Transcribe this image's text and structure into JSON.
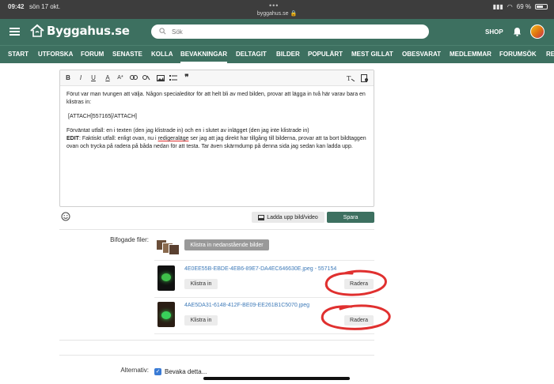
{
  "status_bar": {
    "time": "09:42",
    "date": "sön 17 okt.",
    "url": "byggahus.se 🔒",
    "battery": "69 %"
  },
  "header": {
    "logo": "Byggahus.se",
    "search_placeholder": "Sök",
    "shop": "SHOP"
  },
  "nav": {
    "items": [
      "START",
      "UTFORSKA",
      "FORUM",
      "SENASTE",
      "KOLLA",
      "BEVAKNINGAR",
      "DELTAGIT",
      "BILDER",
      "POPULÄRT",
      "MEST GILLAT",
      "OBESVARAT",
      "MEDLEMMAR",
      "FORUMSÖK",
      "RE"
    ],
    "active": "BEVAKNINGAR"
  },
  "editor": {
    "toolbar": [
      "B",
      "I",
      "U",
      "A",
      "A*",
      "link",
      "unlink",
      "image",
      "list",
      "quote",
      "clear-format",
      "preview"
    ],
    "paragraphs": [
      "Förut var man tvungen att välja. Någon specialeditor för att helt bli av med bilden, provar att lägga in två här varav bara en klistras in:",
      "[ATTACH]557165[/ATTACH]",
      "Förväntat utfall: en i texten (den jag klistrade in) och en i slutet av inlägget (den jag inte klistrade in)"
    ],
    "edit_label": "EDIT",
    "edit_text_pre": ": Faktiskt utfall: enligt ovan, nu i ",
    "edit_link": "redigeraläge",
    "edit_text_post": " ser jag att jag direkt har tillgång till bilderna, provar att ta bort bildtaggen ovan och trycka på radera på båda nedan för att testa. Tar även skärmdump på denna sida jag sedan kan ladda upp.",
    "upload_label": "Ladda upp bild/video",
    "save_label": "Spara"
  },
  "attachments": {
    "label": "Bifogade filer:",
    "insert_all_label": "Klistra in nedanstående bilder",
    "files": [
      {
        "name": "4E0EE55B-EBDE-4EB6-89E7-DA4EC646630E.jpeg - 557154",
        "insert": "Klistra in",
        "delete": "Radera",
        "glow_color": "#3fbf4a"
      },
      {
        "name": "4AE5DA31-6148-412F-BE09-EE261B1C5070.jpeg",
        "insert": "Klistra in",
        "delete": "Radera",
        "glow_color": "#39d05a"
      }
    ]
  },
  "options": {
    "label": "Alternativ:",
    "watch_label": "Bevaka detta..."
  },
  "colors": {
    "brand": "#3d7060",
    "annotation": "#e0302f",
    "link": "#3e7ab8"
  }
}
